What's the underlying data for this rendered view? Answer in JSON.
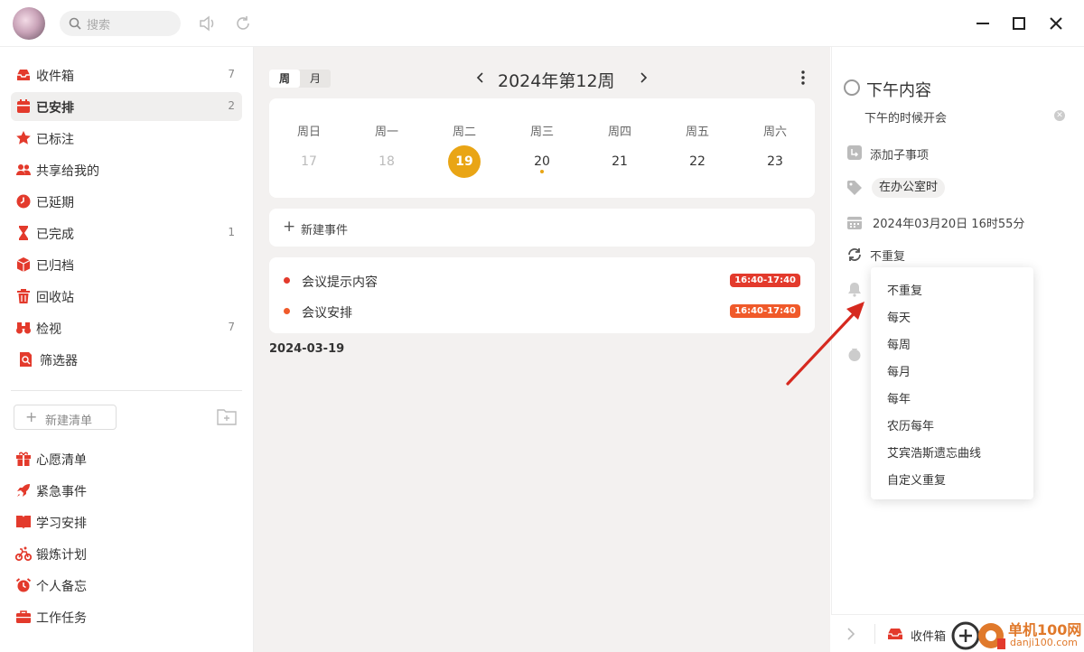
{
  "search": {
    "placeholder": "搜索"
  },
  "sidebar": {
    "items": [
      {
        "label": "收件箱",
        "count": "7"
      },
      {
        "label": "已安排",
        "count": "2"
      },
      {
        "label": "已标注",
        "count": ""
      },
      {
        "label": "共享给我的",
        "count": ""
      },
      {
        "label": "已延期",
        "count": ""
      },
      {
        "label": "已完成",
        "count": "1"
      },
      {
        "label": "已归档",
        "count": ""
      },
      {
        "label": "回收站",
        "count": ""
      },
      {
        "label": "检视",
        "count": "7"
      },
      {
        "label": "筛选器",
        "count": ""
      }
    ],
    "new_list_label": "新建清单",
    "lists": [
      {
        "label": "心愿清单"
      },
      {
        "label": "紧急事件"
      },
      {
        "label": "学习安排"
      },
      {
        "label": "锻炼计划"
      },
      {
        "label": "个人备忘"
      },
      {
        "label": "工作任务"
      }
    ]
  },
  "calendar": {
    "view_tabs": [
      "周",
      "月"
    ],
    "title": "2024年第12周",
    "days": [
      {
        "name": "周日",
        "date": "17"
      },
      {
        "name": "周一",
        "date": "18"
      },
      {
        "name": "周二",
        "date": "19"
      },
      {
        "name": "周三",
        "date": "20"
      },
      {
        "name": "周四",
        "date": "21"
      },
      {
        "name": "周五",
        "date": "22"
      },
      {
        "name": "周六",
        "date": "23"
      }
    ],
    "new_event_label": "新建事件",
    "events": [
      {
        "title": "会议提示内容",
        "time": "16:40-17:40",
        "dot_color": "#e33a2c",
        "tag_color": "#e33a2c"
      },
      {
        "title": "会议安排",
        "time": "16:40-17:40",
        "dot_color": "#f05a2a",
        "tag_color": "#f05a2a"
      }
    ],
    "date_header": "2024-03-19"
  },
  "detail": {
    "title": "下午内容",
    "note": "下午的时候开会",
    "add_subtask": "添加子事项",
    "tag": "在办公室时",
    "datetime": "2024年03月20日 16时55分",
    "repeat": "不重复"
  },
  "repeat_menu": {
    "options": [
      "不重复",
      "每天",
      "每周",
      "每月",
      "每年",
      "农历每年",
      "艾宾浩斯遗忘曲线",
      "自定义重复"
    ]
  },
  "bottom": {
    "list_label": "收件箱"
  },
  "watermark": {
    "brand": "单机100网",
    "url": "danji100.com"
  },
  "colors": {
    "accent": "#e33a2c",
    "today": "#e9a515"
  }
}
